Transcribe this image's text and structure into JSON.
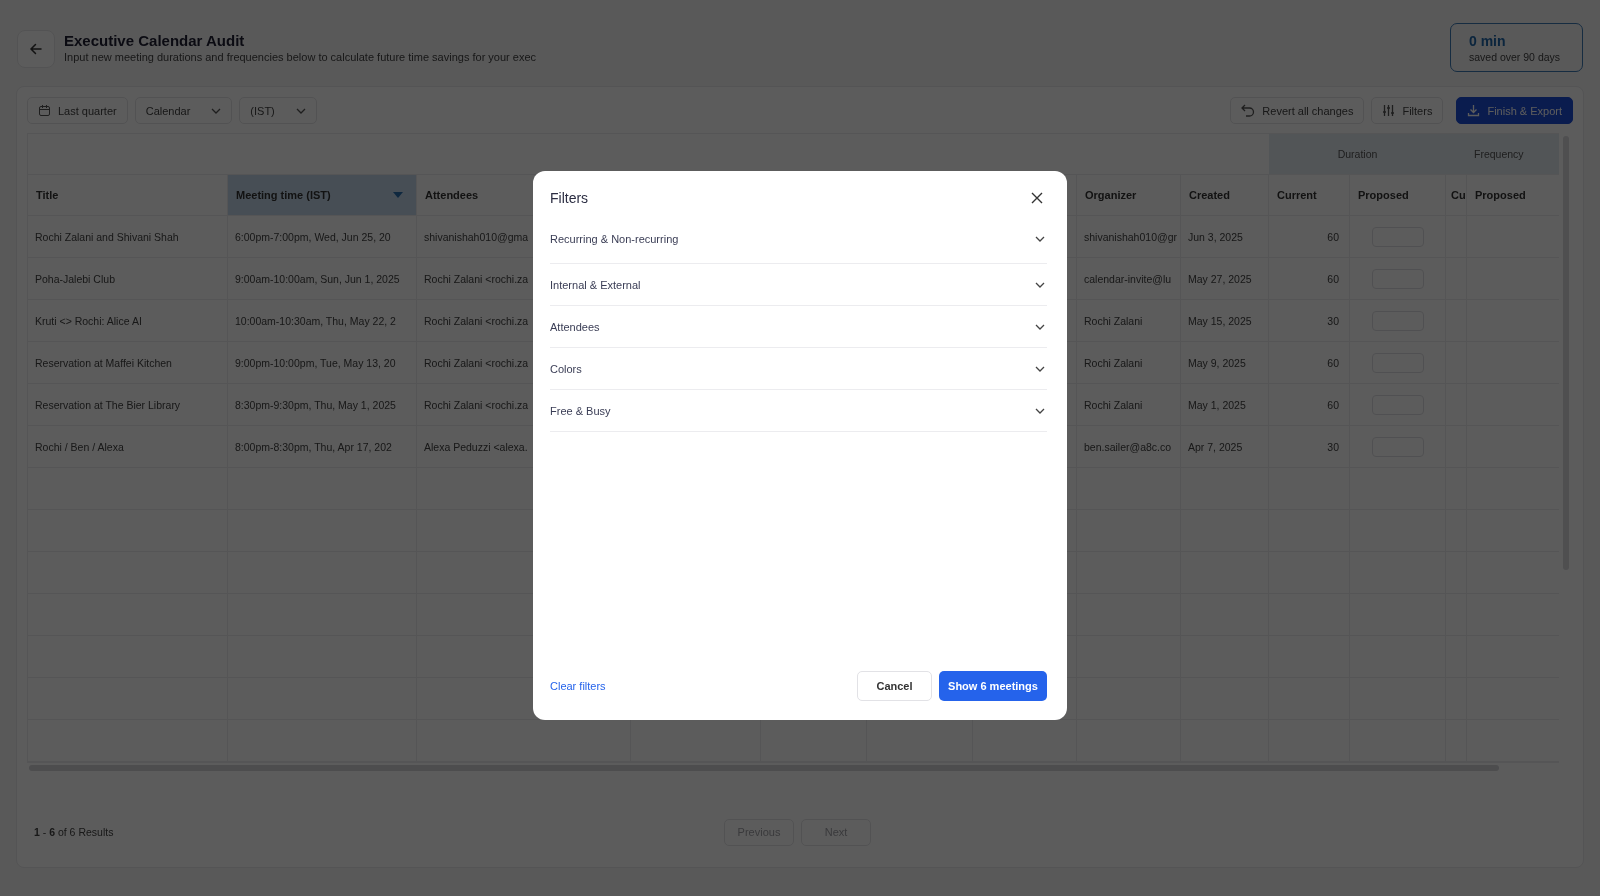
{
  "header": {
    "title": "Executive Calendar Audit",
    "subtitle": "Input new meeting durations and frequencies below to calculate future time savings for your exec",
    "savings": {
      "value": "0 min",
      "caption": "saved over 90 days"
    }
  },
  "toolbar": {
    "left": [
      {
        "label": "Last quarter",
        "kind": "date"
      },
      {
        "label": "Calendar",
        "kind": "dropdown"
      },
      {
        "label": "(IST)",
        "kind": "dropdown"
      }
    ],
    "right": [
      {
        "label": "Revert all changes",
        "kind": "revert"
      },
      {
        "label": "Filters",
        "kind": "filters"
      },
      {
        "label": "Finish & Export",
        "kind": "export"
      }
    ]
  },
  "table": {
    "column_groups": [
      {
        "label": "Duration"
      },
      {
        "label": "Frequency"
      }
    ],
    "columns": [
      {
        "label": "Title",
        "sorted": false
      },
      {
        "label": "Meeting time (IST)",
        "sorted": true
      },
      {
        "label": "Attendees",
        "sorted": false
      },
      {
        "label": "Organizer",
        "sorted": false
      },
      {
        "label": "Created",
        "sorted": false
      },
      {
        "label": "Current",
        "sorted": false
      },
      {
        "label": "Proposed",
        "sorted": false
      },
      {
        "label": "Cu",
        "sorted": false
      },
      {
        "label": "Proposed",
        "sorted": false
      }
    ],
    "rows": [
      {
        "title": "Rochi Zalani and Shivani Shah",
        "time": "6:00pm-7:00pm, Wed, Jun 25, 20",
        "attendees": "shivanishah010@gma",
        "organizer": "shivanishah010@gr",
        "created": "Jun 3, 2025",
        "current": "60"
      },
      {
        "title": "Poha-Jalebi Club",
        "time": "9:00am-10:00am, Sun, Jun 1, 2025",
        "attendees": "Rochi Zalani <rochi.za",
        "organizer": "calendar-invite@lu",
        "created": "May 27, 2025",
        "current": "60"
      },
      {
        "title": "Kruti <> Rochi: Alice AI",
        "time": "10:00am-10:30am, Thu, May 22, 2",
        "attendees": "Rochi Zalani <rochi.za",
        "organizer": "Rochi Zalani",
        "created": "May 15, 2025",
        "current": "30"
      },
      {
        "title": "Reservation at Maffei Kitchen",
        "time": "9:00pm-10:00pm, Tue, May 13, 20",
        "attendees": "Rochi Zalani <rochi.za",
        "organizer": "Rochi Zalani",
        "created": "May 9, 2025",
        "current": "60"
      },
      {
        "title": "Reservation at The Bier Library",
        "time": "8:30pm-9:30pm, Thu, May 1, 2025",
        "attendees": "Rochi Zalani <rochi.za",
        "organizer": "Rochi Zalani",
        "created": "May 1, 2025",
        "current": "60"
      },
      {
        "title": "Rochi / Ben / Alexa",
        "time": "8:00pm-8:30pm, Thu, Apr 17, 202",
        "attendees": "Alexa Peduzzi <alexa.",
        "organizer": "ben.sailer@a8c.co",
        "created": "Apr 7, 2025",
        "current": "30"
      }
    ]
  },
  "pagination": {
    "summary": "**1** - **6** of 6 Results",
    "buttons": [
      {
        "label": "Previous",
        "disabled": true
      },
      {
        "label": "Next",
        "disabled": true
      }
    ]
  },
  "modal": {
    "title": "Filters",
    "sections": [
      {
        "label": "Recurring & Non-recurring",
        "expanded": false
      },
      {
        "label": "Internal & External",
        "expanded": false
      },
      {
        "label": "Attendees",
        "expanded": false
      },
      {
        "label": "Colors",
        "expanded": false
      },
      {
        "label": "Free & Busy",
        "expanded": false
      }
    ],
    "clear_link": "Clear filters",
    "cancel": "Cancel",
    "confirm": "Show 6 meetings"
  }
}
